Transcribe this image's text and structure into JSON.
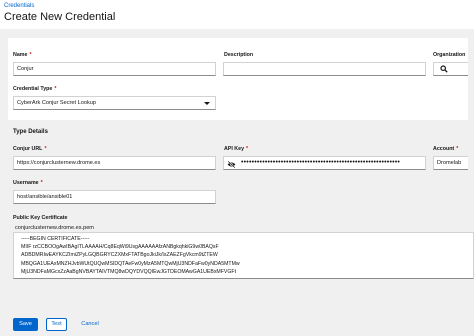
{
  "header": {
    "breadcrumb": "Credentials",
    "title": "Create New Credential"
  },
  "form": {
    "name_label": "Name",
    "name_value": "Conjur",
    "description_label": "Description",
    "description_value": "",
    "organization_label": "Organization",
    "credential_type_label": "Credential Type",
    "credential_type_value": "CyberArk Conjur Secret Lookup",
    "required_marker": "*"
  },
  "type_details": {
    "title": "Type Details",
    "conjur_url_label": "Conjur URL",
    "conjur_url_value": "https://conjurclusternew.drome.es",
    "api_key_label": "API Key",
    "api_key_value": "••••••••••••••••••••••••••••••••••••••••••••••••••••••••••••",
    "account_label": "Account",
    "account_value": "Dromelab",
    "username_label": "Username",
    "username_value": "host/ansible/ansible01",
    "pkc_label": "Public Key Certificate",
    "pkc_filename": "conjurclusternew.drome.es.pem",
    "pkc_text": "-----BEGIN CERTIFICATE-----\nMIIF rzCCBOOgAwIBAgITLAAAAH/Cq8EqWi9UsgAAAAAAfzANBgkqhkiG9w0BAQsF\nADBDMRIwEAYKCZImiZPyLGQBGRYCZXMxFTATBgoJkiJk/IsZAEZFgVkcm9tZTEW\nMBQGA1UEAxMNZHJvbWUtQUQwMSIDQTAeFw0yMzA5MTQwMjU3NDFaFw0yNDA5MTMw\nMjU3NDFaMGcxZzAaBgNVBAYTAIVTMQ8wDQYDVQQIEwJGTDEOMAwGA1UEBxMFVGFt"
  },
  "footer": {
    "save_label": "Save",
    "test_label": "Test",
    "cancel_label": "Cancel"
  },
  "colors": {
    "primary": "#0066cc",
    "required": "#c9190b"
  },
  "icons": {
    "organization_search": "search-icon",
    "api_key_toggle": "eye-slash-icon",
    "credential_type_caret": "caret-down-icon"
  }
}
